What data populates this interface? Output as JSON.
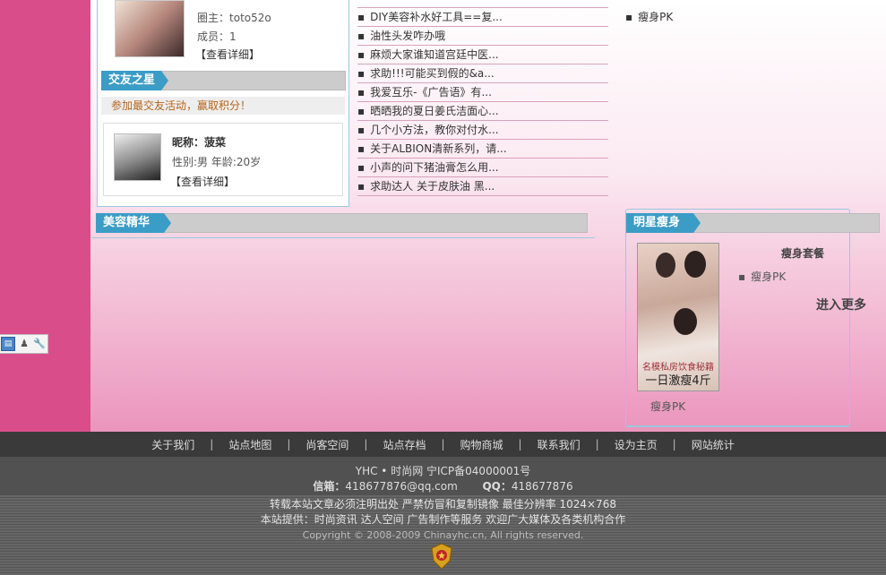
{
  "circle": {
    "owner_label": "圈主：",
    "owner": "toto52o",
    "members_label": "成员：",
    "members": "1",
    "details": "【查看详细】"
  },
  "friend_star": {
    "title": "交友之星",
    "join_note": "参加最交友活动，赢取积分！",
    "nick_label": "昵称：",
    "nick": "菠菜",
    "info": "性别:男  年龄:20岁",
    "details": "【查看详细】"
  },
  "news": [
    "DIY美容补水好工具==复...",
    "油性头发咋办哦",
    "麻烦大家谁知道宫廷中医...",
    "求助!!!可能买到假的&a...",
    "我爱互乐-《广告语》有...",
    "晒晒我的夏日姜氏洁面心...",
    "几个小方法，教你对付水...",
    "关于ALBION清新系列，请...",
    "小声的问下猪油膏怎么用...",
    "求助达人 关于皮肤油 黑..."
  ],
  "right_top_item": "瘦身PK",
  "beauty_section": {
    "title": "美容精华"
  },
  "star_slim": {
    "title": "明星瘦身",
    "package_title": "瘦身套餐",
    "item": "瘦身PK",
    "more": "进入更多",
    "image_caption_small": "名模私房饮食秘籍",
    "image_caption_big": "一日激瘦4斤",
    "image_label": "瘦身PK"
  },
  "footer_nav": [
    "关于我们",
    "站点地图",
    "尚客空间",
    "站点存档",
    "购物商城",
    "联系我们",
    "设为主页",
    "网站统计"
  ],
  "footer": {
    "line1": "YHC • 时尚网      宁ICP备04000001号",
    "mail_label": "信箱：",
    "mail": "418677876@qq.com",
    "qq_label": "QQ：",
    "qq": "418677876",
    "line3": "转载本站文章必须注明出处  严禁仿冒和复制镜像  最佳分辨率  1024×768",
    "line4": "本站提供：时尚资讯  达人空间  广告制作等服务  欢迎广大媒体及各类机构合作",
    "copyright": "Copyright © 2008-2009  Chinayhc.cn,    All rights reserved."
  },
  "colors": {
    "pink": "#d94e8a",
    "tag_blue": "#3b9cc6",
    "footer_dark": "#3a3a3a"
  }
}
